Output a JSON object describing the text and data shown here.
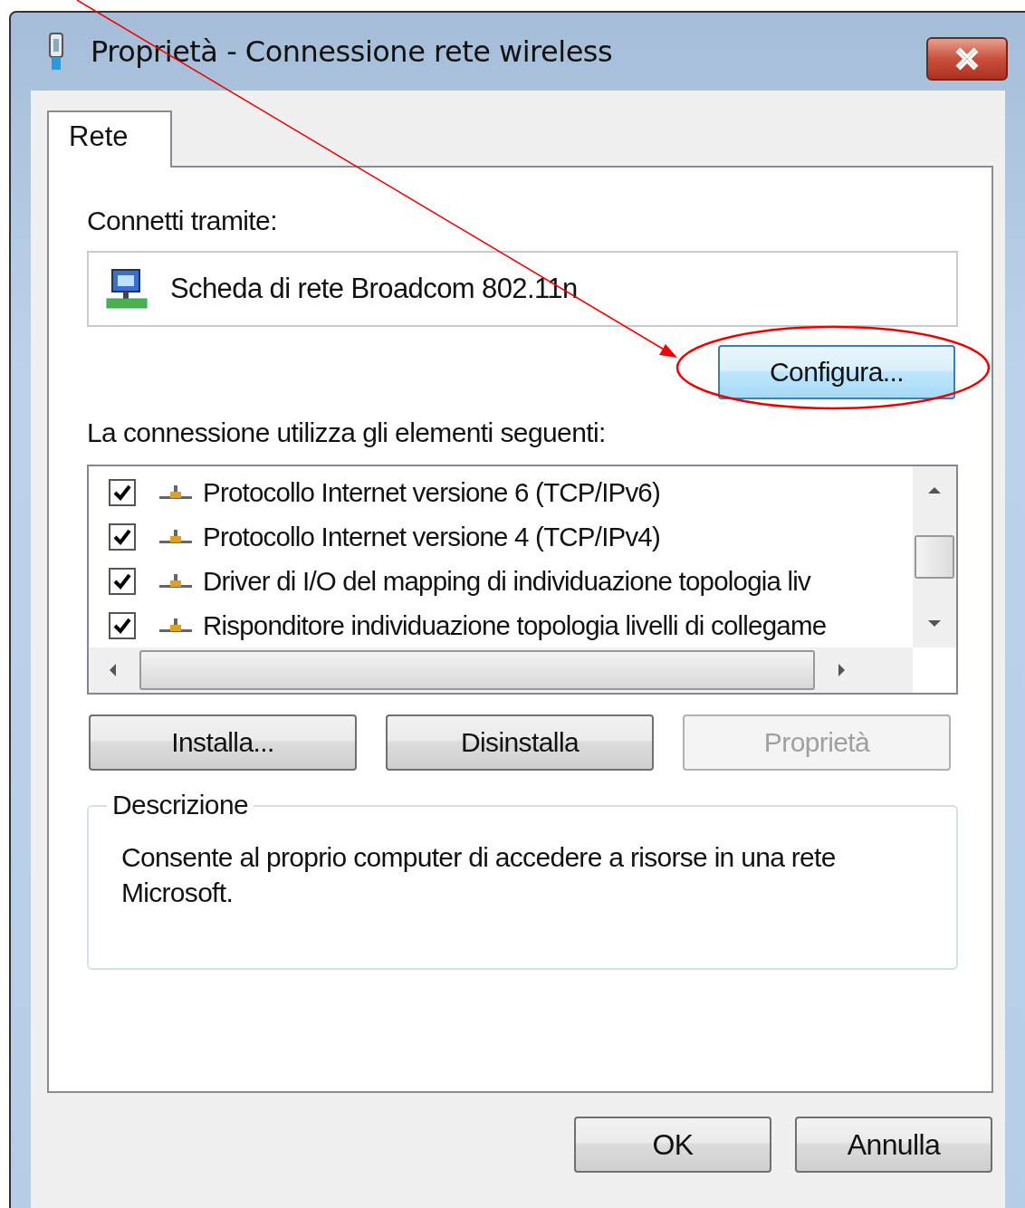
{
  "window": {
    "title": "Proprietà - Connessione rete wireless"
  },
  "tabs": [
    {
      "label": "Rete",
      "selected": true
    }
  ],
  "connect_using": {
    "label": "Connetti tramite:",
    "adapter": "Scheda di rete Broadcom 802.11n",
    "configure_button": "Configura..."
  },
  "items_label": "La connessione utilizza gli elementi seguenti:",
  "items": [
    {
      "label": "Protocollo Internet versione 6 (TCP/IPv6)",
      "checked": true
    },
    {
      "label": "Protocollo Internet versione 4 (TCP/IPv4)",
      "checked": true
    },
    {
      "label": "Driver di I/O del mapping di individuazione topologia liv",
      "checked": true
    },
    {
      "label": "Risponditore individuazione topologia livelli di collegame",
      "checked": true
    }
  ],
  "item_buttons": [
    {
      "label": "Installa...",
      "disabled": false
    },
    {
      "label": "Disinstalla",
      "disabled": false
    },
    {
      "label": "Proprietà",
      "disabled": true
    }
  ],
  "description": {
    "title": "Descrizione",
    "text": "Consente al proprio computer di accedere a risorse in una rete Microsoft."
  },
  "buttons": [
    "OK",
    "Annulla"
  ],
  "annotation": {
    "kind": "arrow_and_circle"
  }
}
